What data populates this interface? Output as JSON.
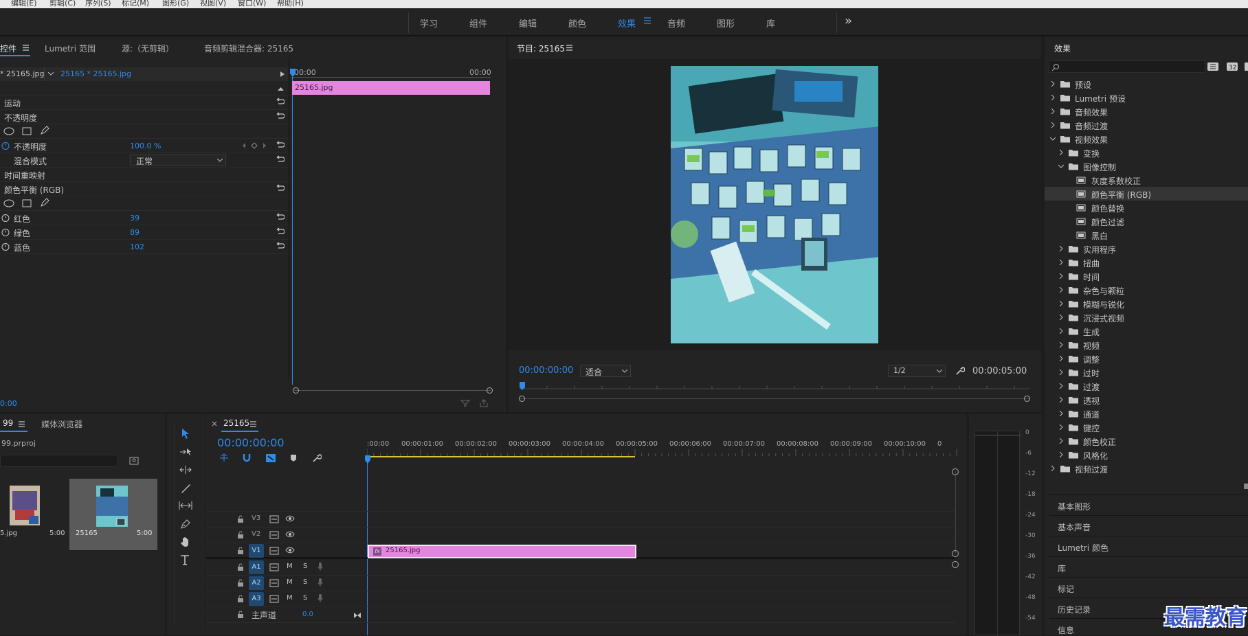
{
  "menubar": [
    "编辑(E)",
    "剪辑(C)",
    "序列(S)",
    "标记(M)",
    "图形(G)",
    "视图(V)",
    "窗口(W)",
    "帮助(H)"
  ],
  "workspaces": {
    "tabs": [
      "学习",
      "组件",
      "编辑",
      "颜色",
      "效果",
      "音频",
      "图形",
      "库"
    ],
    "active": "效果",
    "more": "»"
  },
  "effect_controls": {
    "tabs": [
      "控件",
      "Lumetri 范围",
      "源:（无剪辑）",
      "音频剪辑混合器: 25165"
    ],
    "source_clip": "* 25165.jpg",
    "sequence_clip": "25165 * 25165.jpg",
    "ruler_start": "00:00",
    "ruler_end": "00:00",
    "clip_label": "25165.jpg",
    "timecode": "0:00",
    "rows": {
      "motion": "运动",
      "opacity_group": "不透明度",
      "opacity": "不透明度",
      "opacity_value": "100.0 %",
      "blend_mode": "混合模式",
      "blend_value": "正常",
      "time_remap": "时间重映射",
      "color_balance": "颜色平衡 (RGB)",
      "red": "红色",
      "red_value": "39",
      "green": "绿色",
      "green_value": "89",
      "blue": "蓝色",
      "blue_value": "102"
    }
  },
  "program_monitor": {
    "title": "节目: 25165",
    "timecode": "00:00:00:00",
    "fit": "适合",
    "resolution": "1/2",
    "duration": "00:00:05:00"
  },
  "effects_panel": {
    "title": "效果",
    "search_placeholder": "",
    "tree": [
      {
        "label": "预设",
        "level": 0,
        "type": "folder",
        "open": false
      },
      {
        "label": "Lumetri 预设",
        "level": 0,
        "type": "folder",
        "open": false
      },
      {
        "label": "音频效果",
        "level": 0,
        "type": "folder",
        "open": false
      },
      {
        "label": "音频过渡",
        "level": 0,
        "type": "folder",
        "open": false
      },
      {
        "label": "视频效果",
        "level": 0,
        "type": "folder",
        "open": true
      },
      {
        "label": "变换",
        "level": 1,
        "type": "folder",
        "open": false
      },
      {
        "label": "图像控制",
        "level": 1,
        "type": "folder",
        "open": true
      },
      {
        "label": "灰度系数校正",
        "level": 2,
        "type": "effect"
      },
      {
        "label": "颜色平衡 (RGB)",
        "level": 2,
        "type": "effect",
        "selected": true
      },
      {
        "label": "颜色替换",
        "level": 2,
        "type": "effect"
      },
      {
        "label": "颜色过滤",
        "level": 2,
        "type": "effect"
      },
      {
        "label": "黑白",
        "level": 2,
        "type": "effect"
      },
      {
        "label": "实用程序",
        "level": 1,
        "type": "folder",
        "open": false
      },
      {
        "label": "扭曲",
        "level": 1,
        "type": "folder",
        "open": false
      },
      {
        "label": "时间",
        "level": 1,
        "type": "folder",
        "open": false
      },
      {
        "label": "杂色与颗粒",
        "level": 1,
        "type": "folder",
        "open": false
      },
      {
        "label": "模糊与锐化",
        "level": 1,
        "type": "folder",
        "open": false
      },
      {
        "label": "沉浸式视频",
        "level": 1,
        "type": "folder",
        "open": false
      },
      {
        "label": "生成",
        "level": 1,
        "type": "folder",
        "open": false
      },
      {
        "label": "视频",
        "level": 1,
        "type": "folder",
        "open": false
      },
      {
        "label": "调整",
        "level": 1,
        "type": "folder",
        "open": false
      },
      {
        "label": "过时",
        "level": 1,
        "type": "folder",
        "open": false
      },
      {
        "label": "过渡",
        "level": 1,
        "type": "folder",
        "open": false
      },
      {
        "label": "透视",
        "level": 1,
        "type": "folder",
        "open": false
      },
      {
        "label": "通道",
        "level": 1,
        "type": "folder",
        "open": false
      },
      {
        "label": "键控",
        "level": 1,
        "type": "folder",
        "open": false
      },
      {
        "label": "颜色校正",
        "level": 1,
        "type": "folder",
        "open": false
      },
      {
        "label": "风格化",
        "level": 1,
        "type": "folder",
        "open": false
      },
      {
        "label": "视频过渡",
        "level": 0,
        "type": "folder",
        "open": false
      }
    ],
    "sections": [
      "基本图形",
      "基本声音",
      "Lumetri 颜色",
      "库",
      "标记",
      "历史记录",
      "信息"
    ]
  },
  "project_panel": {
    "tabs": [
      "99",
      "媒体浏览器"
    ],
    "project_name": "99.prproj",
    "items": [
      {
        "name": "5.jpg",
        "duration": "5:00"
      },
      {
        "name": "25165",
        "duration": "5:00"
      }
    ]
  },
  "timeline": {
    "sequence": "25165",
    "timecode": "00:00:00:00",
    "ruler": [
      ":00:00",
      "00:00:01:00",
      "00:00:02:00",
      "00:00:03:00",
      "00:00:04:00",
      "00:00:05:00",
      "00:00:06:00",
      "00:00:07:00",
      "00:00:08:00",
      "00:00:09:00",
      "00:00:10:00",
      "0"
    ],
    "video_tracks": [
      "V3",
      "V2",
      "V1"
    ],
    "audio_tracks": [
      "A1",
      "A2",
      "A3"
    ],
    "mute": "M",
    "solo": "S",
    "master": "主声道",
    "master_value": "0.0",
    "clip_label": "25165.jpg",
    "fx_badge": "fx"
  },
  "audio_meter": {
    "scale": [
      "0",
      "-6",
      "-12",
      "-18",
      "-24",
      "-30",
      "-36",
      "-42",
      "-48",
      "-54"
    ]
  },
  "watermark": "最需教育",
  "colors": {
    "accent": "#2d8ceb",
    "clip_pink": "#e486e0",
    "panel": "#232323",
    "track_blue": "#1f4a73"
  }
}
